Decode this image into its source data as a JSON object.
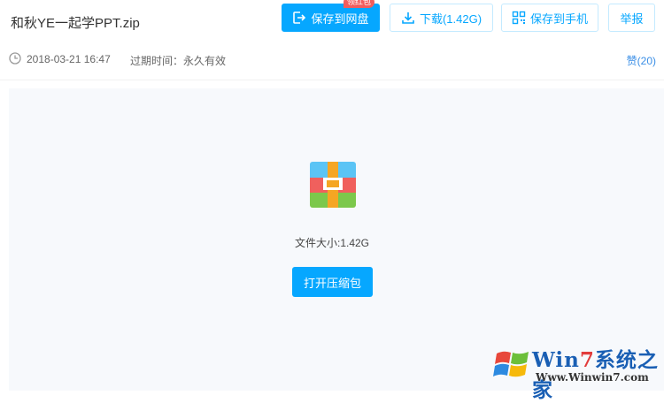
{
  "header": {
    "file_title": "和秋YE一起学PPT.zip",
    "save_netdisk_label": "保存到网盘",
    "save_badge": "领红包",
    "download_label": "下载(1.42G)",
    "save_phone_label": "保存到手机",
    "report_label": "举报"
  },
  "meta": {
    "time": "2018-03-21 16:47",
    "expire": "过期时间：永久有效",
    "like": "赞(20)"
  },
  "preview": {
    "size_text": "文件大小:1.42G",
    "open_label": "打开压缩包"
  },
  "watermark": {
    "brand_pre": "Win",
    "brand_seven": "7",
    "brand_post": "系统之家",
    "url": "Www.Winwin7.com"
  },
  "colors": {
    "accent": "#06a7ff",
    "badge": "#f25d5d",
    "link": "#3a8ee6"
  }
}
